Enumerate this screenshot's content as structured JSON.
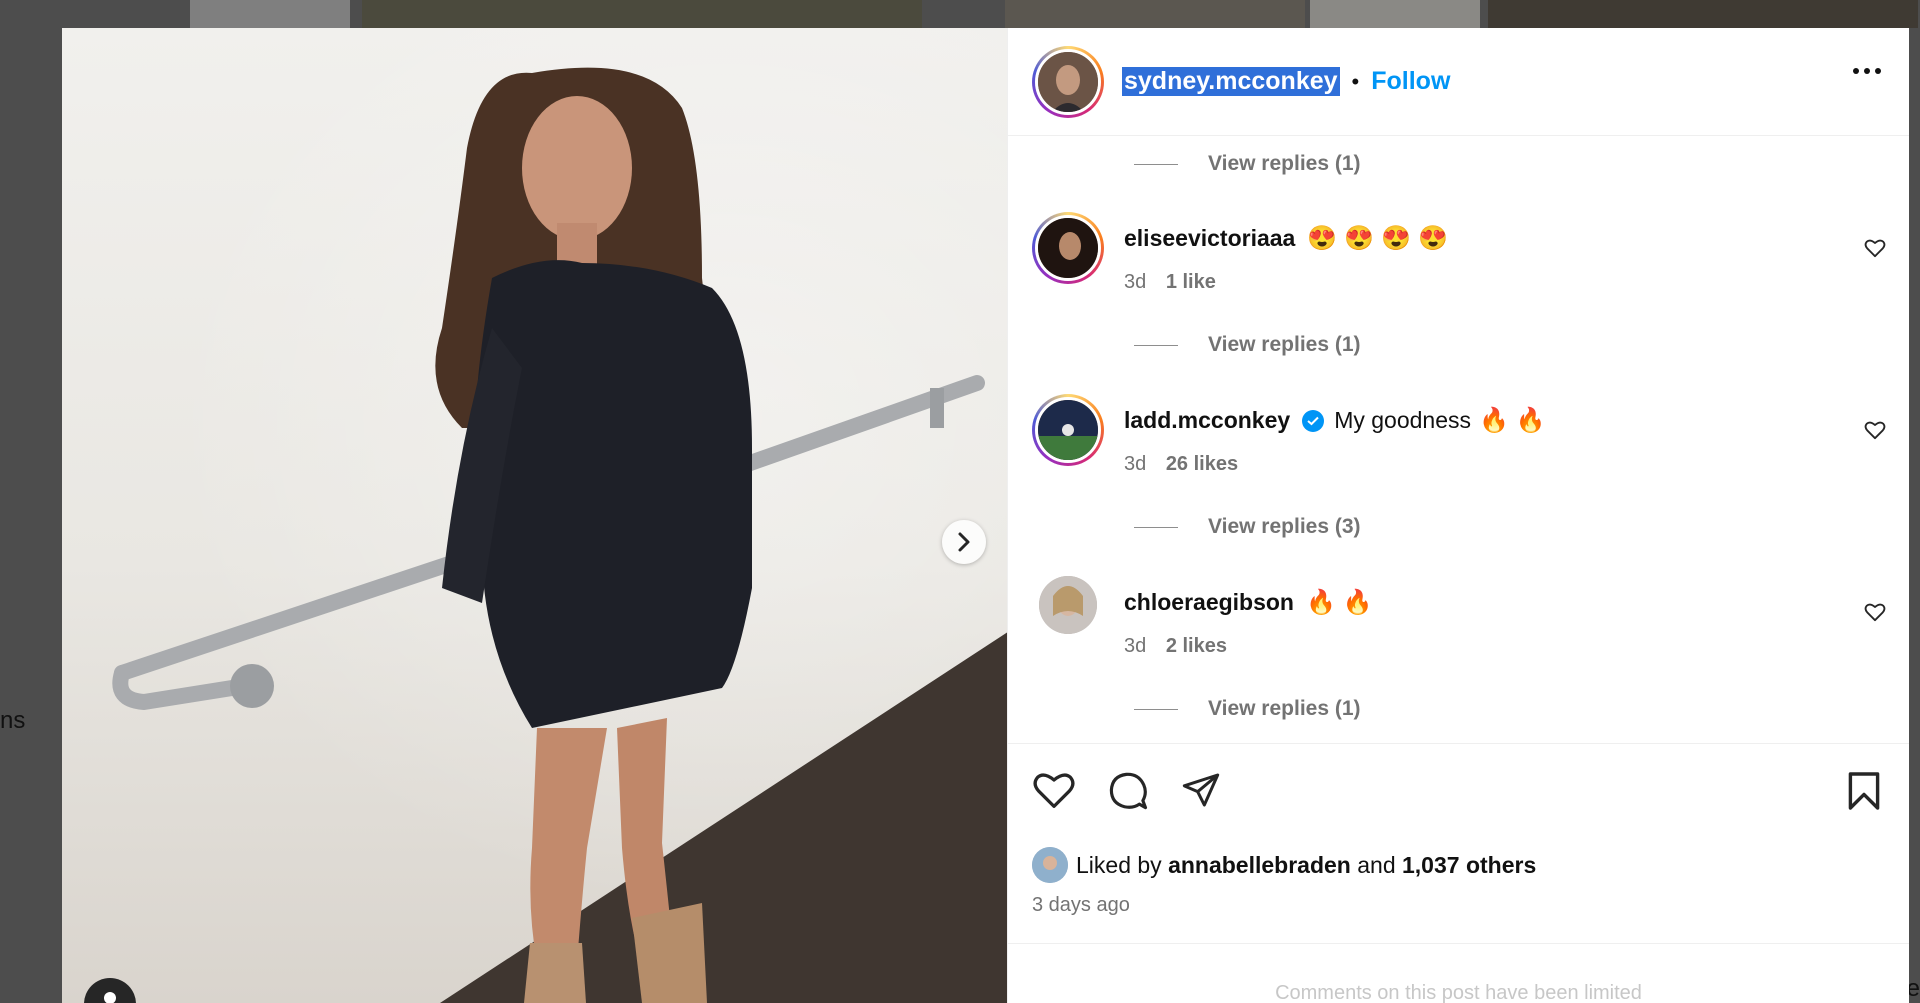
{
  "background": {
    "side_text": "ns",
    "right_text": "e"
  },
  "media": {
    "next_icon": "chevron-right-icon",
    "tag_icon": "user-tag-icon"
  },
  "header": {
    "username": "sydney.mcconkey",
    "separator": "•",
    "follow_label": "Follow",
    "more_icon": "more-horizontal-icon"
  },
  "comments": [
    {
      "username": "eliseevictoriaaa",
      "emojis": [
        "😍",
        "😍",
        "😍",
        "😍"
      ],
      "text": "",
      "age": "3d",
      "likes": "1 like",
      "replies": "View replies (1)",
      "verified": false
    },
    {
      "username": "ladd.mcconkey",
      "emojis": [
        "🔥",
        "🔥"
      ],
      "text": "My goodness",
      "age": "3d",
      "likes": "26 likes",
      "replies": "View replies (3)",
      "verified": true
    },
    {
      "username": "chloeraegibson",
      "emojis": [
        "🔥",
        "🔥"
      ],
      "text": "",
      "age": "3d",
      "likes": "2 likes",
      "replies": "View replies (1)",
      "verified": false
    }
  ],
  "top_replies": "View replies (1)",
  "footer": {
    "liked_by_prefix": "Liked by",
    "liked_by_user": "annabellebraden",
    "liked_by_and": "and",
    "liked_by_others": "1,037 others",
    "time_ago": "3 days ago",
    "limited_notice": "Comments on this post have been limited"
  },
  "colors": {
    "follow": "#0095f6",
    "muted": "#737373",
    "selection": "#2f6fd9"
  }
}
